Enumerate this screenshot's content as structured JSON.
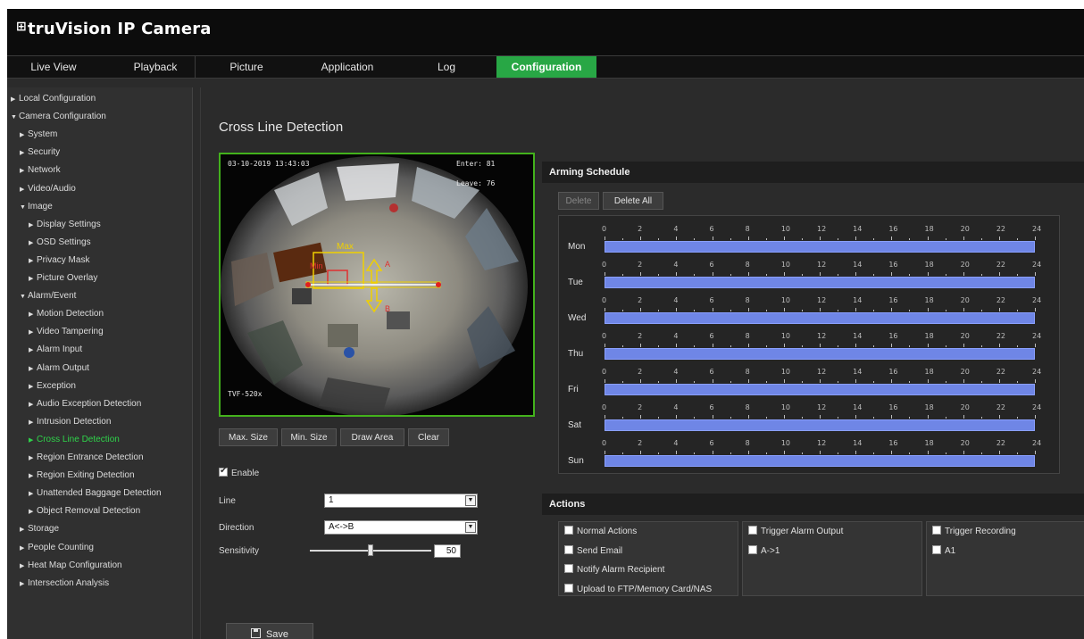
{
  "app": {
    "title": "truVision IP Camera",
    "logo_mark": "⊞"
  },
  "nav": {
    "tabs": [
      {
        "label": "Live View"
      },
      {
        "label": "Playback"
      },
      {
        "label": "Picture"
      },
      {
        "label": "Application"
      },
      {
        "label": "Log"
      },
      {
        "label": "Configuration",
        "active": true
      }
    ]
  },
  "sidebar": {
    "items": [
      {
        "label": "Local Configuration",
        "level": 0,
        "expanded": false
      },
      {
        "label": "Camera Configuration",
        "level": 0,
        "expanded": true
      },
      {
        "label": "System",
        "level": 1,
        "expanded": false
      },
      {
        "label": "Security",
        "level": 1,
        "expanded": false
      },
      {
        "label": "Network",
        "level": 1,
        "expanded": false
      },
      {
        "label": "Video/Audio",
        "level": 1,
        "expanded": false
      },
      {
        "label": "Image",
        "level": 1,
        "expanded": true
      },
      {
        "label": "Display Settings",
        "level": 2,
        "expanded": false
      },
      {
        "label": "OSD Settings",
        "level": 2,
        "expanded": false
      },
      {
        "label": "Privacy Mask",
        "level": 2,
        "expanded": false
      },
      {
        "label": "Picture Overlay",
        "level": 2,
        "expanded": false
      },
      {
        "label": "Alarm/Event",
        "level": 1,
        "expanded": true
      },
      {
        "label": "Motion Detection",
        "level": 2,
        "expanded": false
      },
      {
        "label": "Video Tampering",
        "level": 2,
        "expanded": false
      },
      {
        "label": "Alarm Input",
        "level": 2,
        "expanded": false
      },
      {
        "label": "Alarm Output",
        "level": 2,
        "expanded": false
      },
      {
        "label": "Exception",
        "level": 2,
        "expanded": false
      },
      {
        "label": "Audio Exception Detection",
        "level": 2,
        "expanded": false
      },
      {
        "label": "Intrusion Detection",
        "level": 2,
        "expanded": false
      },
      {
        "label": "Cross Line Detection",
        "level": 2,
        "expanded": false,
        "active": true
      },
      {
        "label": "Region Entrance Detection",
        "level": 2,
        "expanded": false
      },
      {
        "label": "Region Exiting Detection",
        "level": 2,
        "expanded": false
      },
      {
        "label": "Unattended Baggage Detection",
        "level": 2,
        "expanded": false
      },
      {
        "label": "Object Removal Detection",
        "level": 2,
        "expanded": false
      },
      {
        "label": "Storage",
        "level": 1,
        "expanded": false
      },
      {
        "label": "People Counting",
        "level": 1,
        "expanded": false
      },
      {
        "label": "Heat Map Configuration",
        "level": 1,
        "expanded": false
      },
      {
        "label": "Intersection Analysis",
        "level": 1,
        "expanded": false
      }
    ]
  },
  "main": {
    "page_title": "Cross Line Detection",
    "video": {
      "timestamp": "03-10-2019 13:43:03",
      "enter": "Enter: 81",
      "leave": "Leave: 76",
      "model": "TVF-520x",
      "labels": {
        "max": "Max",
        "min": "Min",
        "a": "A",
        "b": "B"
      }
    },
    "draw_buttons": {
      "max_size": "Max. Size",
      "min_size": "Min. Size",
      "draw_area": "Draw Area",
      "clear": "Clear"
    },
    "enable": {
      "label": "Enable",
      "checked": true
    },
    "line": {
      "label": "Line",
      "value": "1"
    },
    "direction": {
      "label": "Direction",
      "value": "A<->B"
    },
    "sensitivity": {
      "label": "Sensitivity",
      "value": "50",
      "fraction": 0.5
    },
    "save_label": "Save"
  },
  "schedule": {
    "title": "Arming Schedule",
    "delete_label": "Delete",
    "delete_all_label": "Delete All",
    "days": [
      "Mon",
      "Tue",
      "Wed",
      "Thu",
      "Fri",
      "Sat",
      "Sun"
    ],
    "hour_labels": [
      "0",
      "2",
      "4",
      "6",
      "8",
      "10",
      "12",
      "14",
      "16",
      "18",
      "20",
      "22",
      "24"
    ],
    "bar_color": "#6f86e6"
  },
  "actions": {
    "title": "Actions",
    "columns": [
      {
        "header": "Normal Actions",
        "items": [
          "Send Email",
          "Notify Alarm Recipient",
          "Upload to FTP/Memory Card/NAS"
        ]
      },
      {
        "header": "Trigger Alarm Output",
        "items": [
          "A->1"
        ]
      },
      {
        "header": "Trigger Recording",
        "items": [
          "A1"
        ]
      }
    ]
  },
  "colors": {
    "accent": "#28a745",
    "active_text": "#2fd34a",
    "frame_border": "#43b21c"
  }
}
